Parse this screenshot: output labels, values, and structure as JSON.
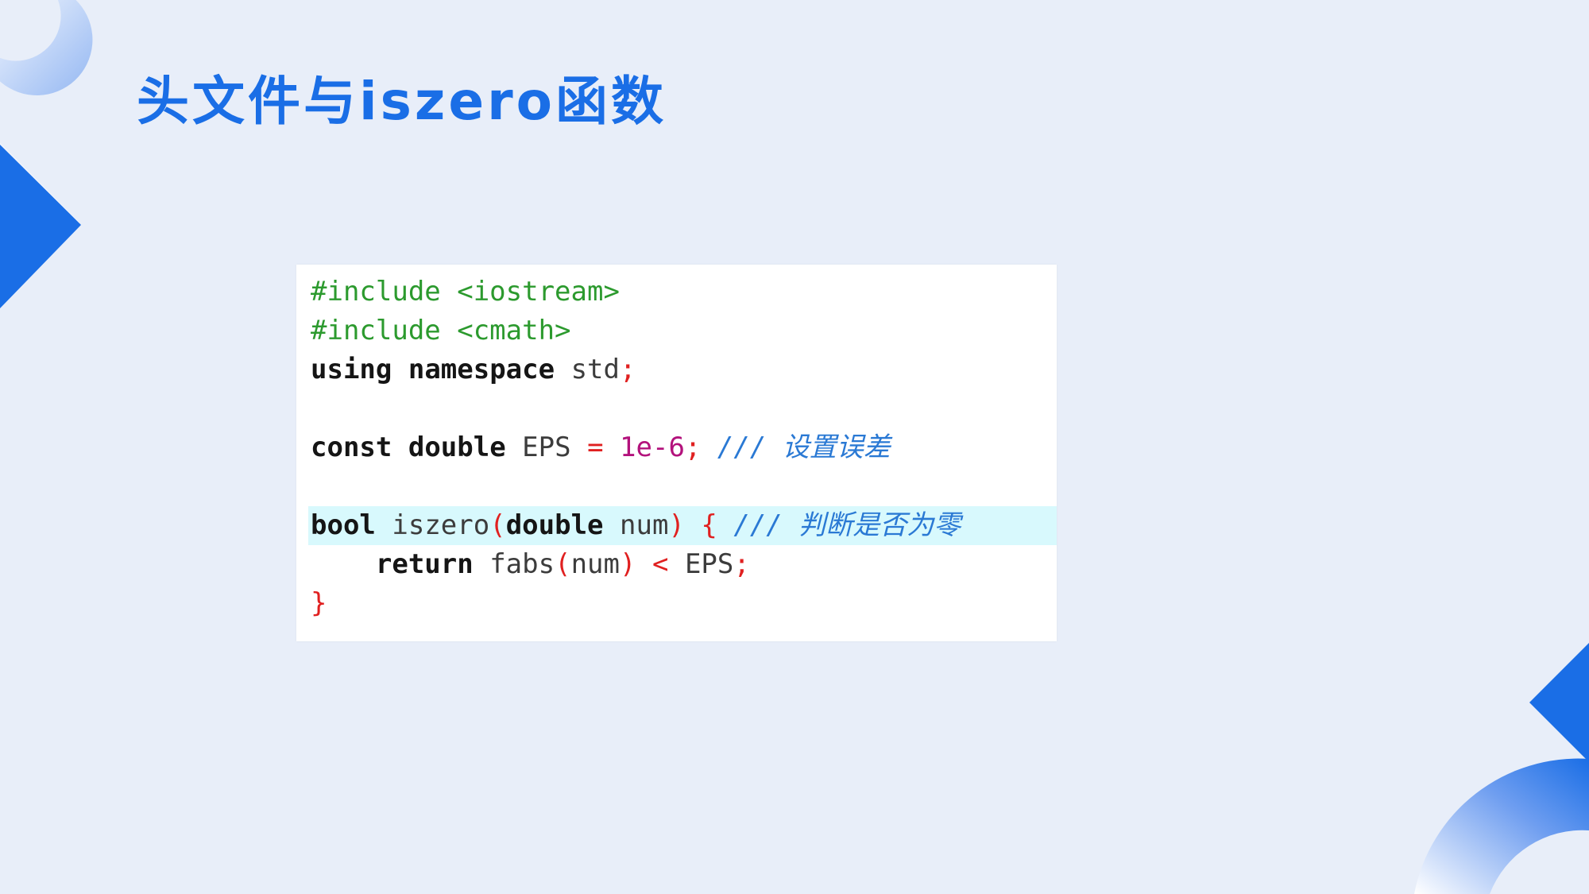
{
  "slide": {
    "title": "头文件与iszero函数"
  },
  "code": {
    "line1": {
      "directive": "#include <iostream>"
    },
    "line2": {
      "directive": "#include <cmath>"
    },
    "line3": {
      "kw1": "using",
      "sp1": " ",
      "kw2": "namespace",
      "sp2": " ",
      "ident": "std",
      "semi": ";"
    },
    "line5": {
      "kw1": "const",
      "sp1": " ",
      "kw2": "double",
      "sp2": " ",
      "ident": "EPS",
      "sp3": " ",
      "op": "=",
      "sp4": " ",
      "num": "1e-6",
      "semi": ";",
      "sp5": " ",
      "comment": "/// 设置误差"
    },
    "line7": {
      "kw1": "bool",
      "sp1": " ",
      "fname": "iszero",
      "lparen": "(",
      "kw2": "double",
      "sp2": " ",
      "param": "num",
      "rparen": ")",
      "sp3": " ",
      "lbrace": "{",
      "sp4": " ",
      "comment": "/// 判断是否为零"
    },
    "line8": {
      "indent": "    ",
      "kw": "return",
      "sp1": " ",
      "fname": "fabs",
      "lparen": "(",
      "arg": "num",
      "rparen": ")",
      "sp2": " ",
      "op": "<",
      "sp3": " ",
      "ident": "EPS",
      "semi": ";"
    },
    "line9": {
      "rbrace": "}"
    }
  },
  "colors": {
    "background": "#e8eef9",
    "accent_blue": "#1a6ee6",
    "highlight_line": "#d8f9fd",
    "preprocessor": "#2c9a2e",
    "punctuation": "#e02020",
    "number": "#b3127c",
    "comment": "#2a79d4"
  }
}
